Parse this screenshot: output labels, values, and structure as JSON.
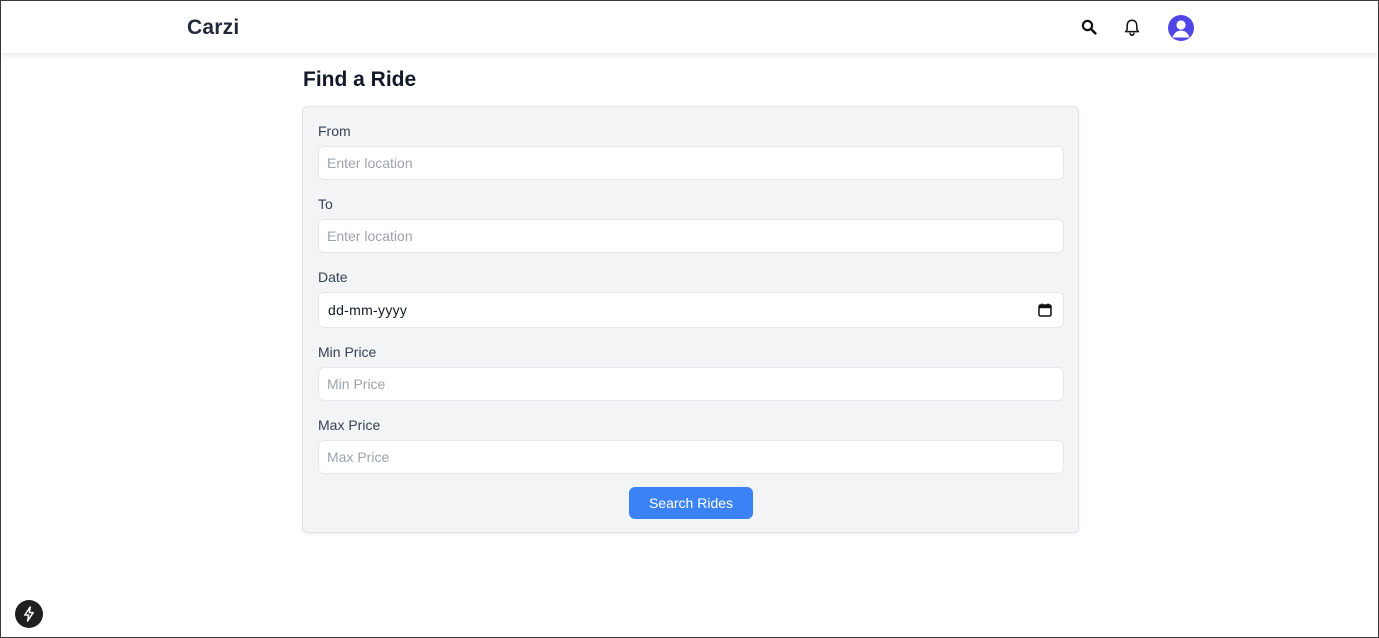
{
  "header": {
    "brand": "Carzi",
    "icons": [
      "search-icon",
      "bell-icon",
      "user-avatar-icon"
    ],
    "avatar_color": "#4f46e5"
  },
  "page": {
    "title": "Find a Ride"
  },
  "form": {
    "from": {
      "label": "From",
      "placeholder": "Enter location",
      "value": ""
    },
    "to": {
      "label": "To",
      "placeholder": "Enter location",
      "value": ""
    },
    "date": {
      "label": "Date",
      "value": "dd-mm-yyyy",
      "icon": "calendar-icon"
    },
    "min_price": {
      "label": "Min Price",
      "placeholder": "Min Price",
      "value": ""
    },
    "max_price": {
      "label": "Max Price",
      "placeholder": "Max Price",
      "value": ""
    },
    "submit_label": "Search Rides",
    "accent_color": "#3b82f6"
  },
  "floating": {
    "icon": "bolt-icon"
  }
}
